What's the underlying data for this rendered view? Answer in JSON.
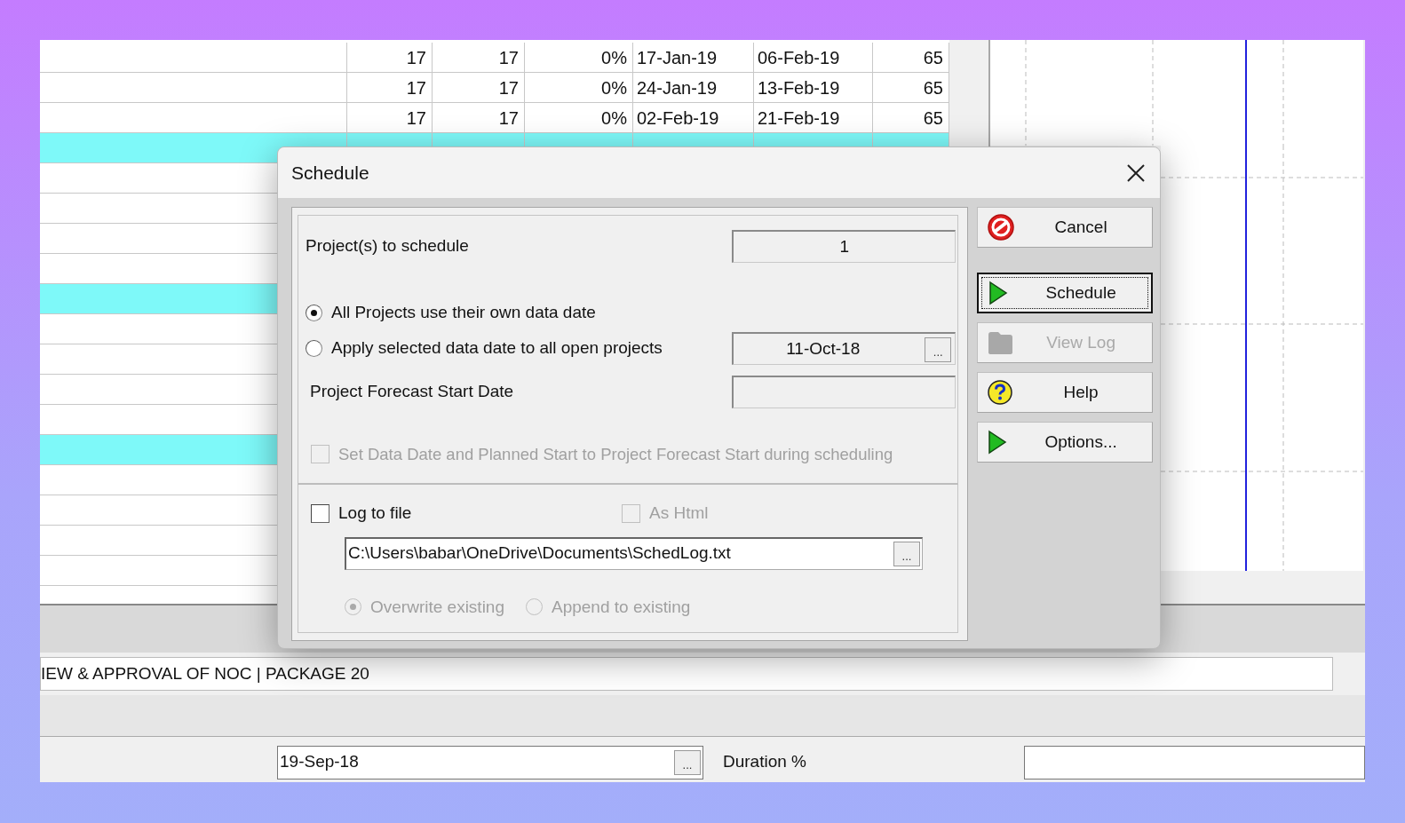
{
  "table": {
    "rows": [
      {
        "cells": [
          "17",
          "17",
          "0%",
          "17-Jan-19",
          "06-Feb-19",
          "65"
        ],
        "highlighted": false
      },
      {
        "cells": [
          "17",
          "17",
          "0%",
          "24-Jan-19",
          "13-Feb-19",
          "65"
        ],
        "highlighted": false
      },
      {
        "cells": [
          "17",
          "17",
          "0%",
          "02-Feb-19",
          "21-Feb-19",
          "65"
        ],
        "highlighted": false
      },
      {
        "highlighted": true
      },
      {
        "highlighted": false
      },
      {
        "highlighted": false
      },
      {
        "highlighted": false
      },
      {
        "highlighted": false
      },
      {
        "highlighted": true
      },
      {
        "highlighted": false
      },
      {
        "highlighted": false
      },
      {
        "highlighted": false
      },
      {
        "highlighted": false
      },
      {
        "highlighted": true
      },
      {
        "highlighted": false
      },
      {
        "highlighted": false
      },
      {
        "highlighted": false
      },
      {
        "highlighted": false
      }
    ]
  },
  "details": {
    "description": "IEW & APPROVAL OF NOC | PACKAGE 20",
    "date_value": "19-Sep-18",
    "date_button": "...",
    "duration_label": "Duration %"
  },
  "dialog": {
    "title": "Schedule",
    "projects_label": "Project(s) to schedule",
    "projects_value": "1",
    "date_options": [
      {
        "label": "All Projects use their own data date",
        "selected": true
      },
      {
        "label": "Apply selected data date to all open projects",
        "selected": false
      }
    ],
    "data_date": "11-Oct-18",
    "data_date_button": "...",
    "forecast_label": "Project Forecast Start Date",
    "set_start": {
      "label": "Set Data Date and Planned Start to Project Forecast Start during scheduling",
      "checked": false,
      "disabled": true
    },
    "log_to_file": {
      "label": "Log to file",
      "checked": false,
      "disabled": false
    },
    "as_html": {
      "label": "As Html",
      "checked": false,
      "disabled": true
    },
    "log_path": "C:\\Users\\babar\\OneDrive\\Documents\\SchedLog.txt",
    "log_path_button": "...",
    "write_modes": [
      {
        "label": "Overwrite existing",
        "selected": true,
        "disabled": true
      },
      {
        "label": "Append to existing",
        "selected": false,
        "disabled": true
      }
    ],
    "buttons": [
      {
        "label": "Cancel",
        "kind": "stop",
        "focused": false,
        "disabled": false
      },
      {
        "label": "Schedule",
        "kind": "play",
        "focused": true,
        "disabled": false
      },
      {
        "label": "View Log",
        "kind": "folder",
        "focused": false,
        "disabled": true
      },
      {
        "label": "Help",
        "kind": "help",
        "focused": false,
        "disabled": false
      },
      {
        "label": "Options...",
        "kind": "play",
        "focused": false,
        "disabled": false
      }
    ]
  }
}
